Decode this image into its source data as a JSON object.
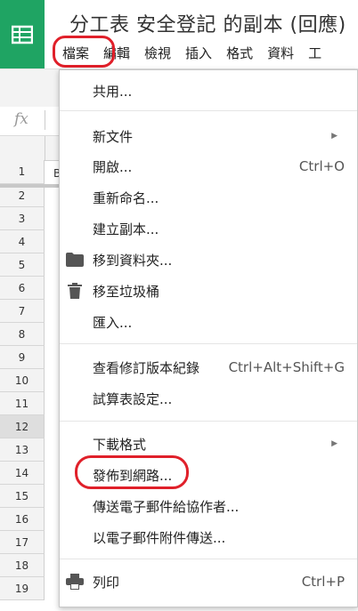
{
  "doc": {
    "title": "分工表 安全登記 的副本 (回應)"
  },
  "menubar": [
    "檔案",
    "編輯",
    "檢視",
    "插入",
    "格式",
    "資料",
    "工"
  ],
  "formula": {
    "icon": "fx"
  },
  "grid": {
    "rows": [
      "1",
      "2",
      "3",
      "4",
      "5",
      "6",
      "7",
      "8",
      "9",
      "10",
      "11",
      "12",
      "13",
      "14",
      "15",
      "16",
      "17",
      "18",
      "19"
    ],
    "selected_row": "12",
    "cell_fragment": "B"
  },
  "file_menu": {
    "share": "共用...",
    "new": "新文件",
    "open": "開啟...",
    "open_shortcut": "Ctrl+O",
    "rename": "重新命名...",
    "copy": "建立副本...",
    "move": "移到資料夾...",
    "trash": "移至垃圾桶",
    "import": "匯入...",
    "revisions": "查看修訂版本紀錄",
    "revisions_shortcut": "Ctrl+Alt+Shift+G",
    "settings": "試算表設定...",
    "download": "下載格式",
    "publish": "發佈到網路...",
    "email_collab": "傳送電子郵件給協作者...",
    "email_attach": "以電子郵件附件傳送...",
    "print": "列印",
    "print_shortcut": "Ctrl+P"
  },
  "icons": {
    "folder": "folder-icon",
    "trash": "trash-icon",
    "print": "printer-icon",
    "submenu": "submenu-arrow-icon"
  },
  "colors": {
    "brand": "#1fa463",
    "highlight": "#e0202a"
  }
}
